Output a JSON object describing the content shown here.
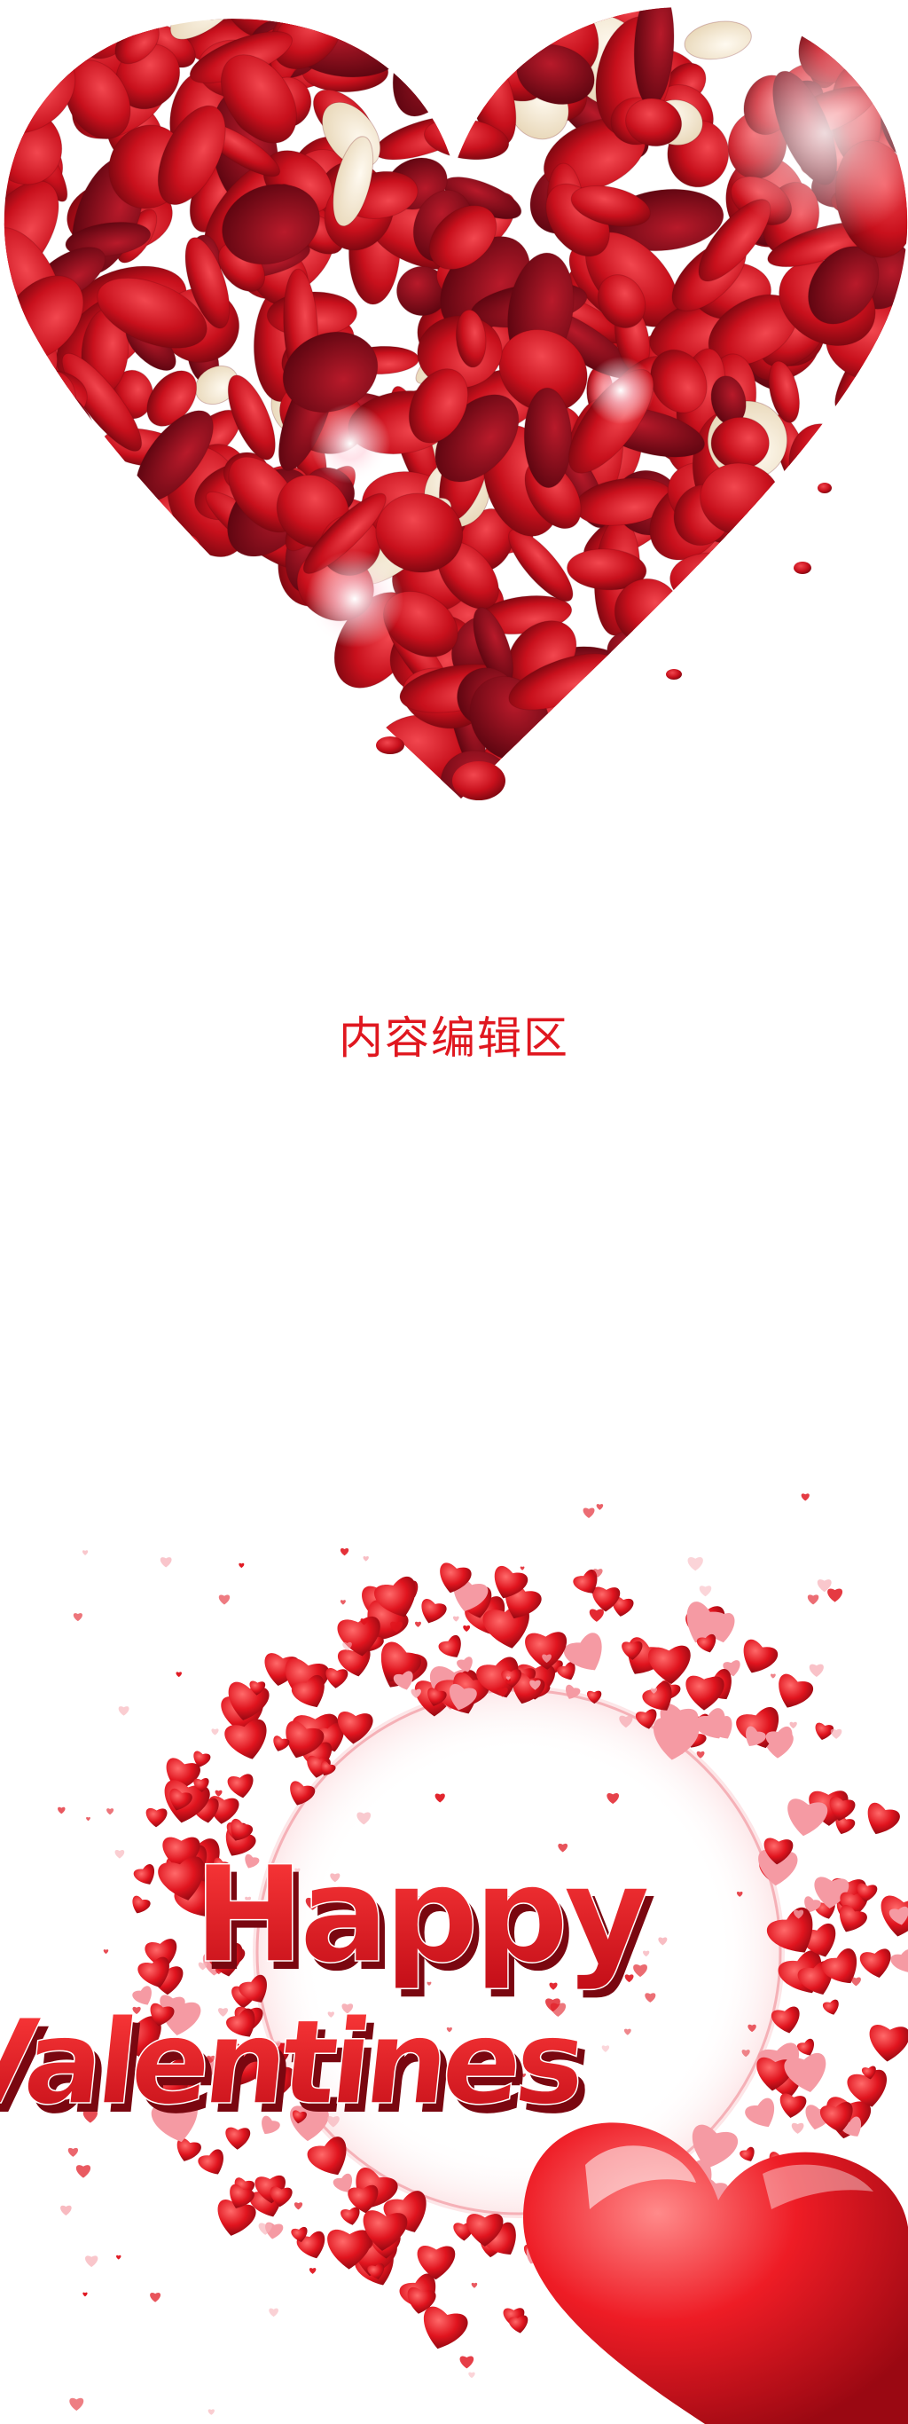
{
  "content_area": {
    "label": "内容编辑区"
  },
  "art": {
    "headline_line1": "Happy",
    "headline_line2": "Valentines",
    "colors": {
      "primary_red": "#d4101c",
      "deep_red": "#8e0912",
      "petal_cream": "#f6e9d2",
      "background": "#ffffff"
    }
  }
}
